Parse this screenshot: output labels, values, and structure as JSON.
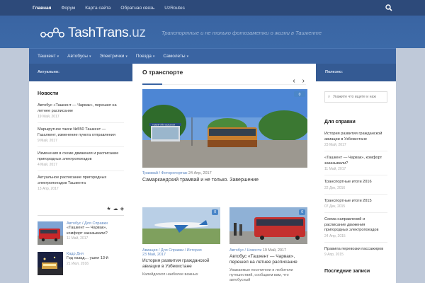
{
  "topnav": [
    "Главная",
    "Форум",
    "Карта сайта",
    "Обратная связь",
    "UzRoutes"
  ],
  "logo": {
    "name": "TashTrans",
    "suffix": ".uz"
  },
  "tagline": "Транспортные и не только фотозаметки о жизни в Ташкенте",
  "mainnav": [
    "Ташкент",
    "Автобусы",
    "Электрички",
    "Поезда",
    "Самолеты"
  ],
  "subbar": {
    "left": "Актуально:",
    "right": "Полезно:"
  },
  "left": {
    "news_heading": "Новости",
    "news": [
      {
        "title": "Автобус «Ташкент — Чарвак», перешел на летнее расписание",
        "date": "19 Май, 2017"
      },
      {
        "title": "Маршрутное такси №550 Ташкент — Газалкент, изменение пункта отправления",
        "date": "9 Май, 2017"
      },
      {
        "title": "Изменения в схеме движения и расписание пригородных электропоездов",
        "date": "4 Май, 2017"
      },
      {
        "title": "Актуальное расписание пригородных электропоездов Ташкента",
        "date": "13 Апр, 2017"
      }
    ],
    "posts": [
      {
        "cat": "Автобус / Для Справки",
        "title": "«Ташкент — Чарвак», комфорт заказывали?",
        "date": "11 Май, 2017"
      },
      {
        "cat": "Кадр Дня",
        "title": "Год назад… ушел 13-й",
        "date": "21 Июл, 2016"
      }
    ]
  },
  "main": {
    "title": "О транспорте",
    "feature": {
      "cat": "Трамвай / Фоторепортаж",
      "date": "24 Апр, 2017",
      "title": "Самаркандский трамвай и не только. Завершение",
      "comments": "0",
      "sign": "ТЕМИР ЙЎЛ ВОКЗАЛИ"
    },
    "posts": [
      {
        "cat": "Авиация / Для Справки / История",
        "date": "23 Май, 2017",
        "title": "История развития гражданской авиации в Узбекистане",
        "excerpt": "Калейдоскоп наиболее важных",
        "comments": "0"
      },
      {
        "cat": "Автобус / Новости",
        "date": "19 Май, 2017",
        "title": "Автобус «Ташкент — Чарвак», перешел на летнее расписание",
        "excerpt": "Уважаемые посетители и любители путешествий, сообщаем вам, что автобусный",
        "comments": "0"
      }
    ]
  },
  "right": {
    "search_placeholder": "Укажите что ищете и наж",
    "heading": "Для справки",
    "items": [
      {
        "title": "История развития гражданской авиации в Узбекистане",
        "date": "23 Май, 2017"
      },
      {
        "title": "«Ташкент — Чарвак», комфорт заказывали?",
        "date": "11 Май, 2017"
      },
      {
        "title": "Транспортные итоги 2016",
        "date": "22 Дек, 2016"
      },
      {
        "title": "Транспортные итоги 2015",
        "date": "07 Дек, 2015"
      },
      {
        "title": "Схема направлений и расписание движения пригородных электропоездов",
        "date": "24 Апр, 2015"
      },
      {
        "title": "Правила перевозки пассажиров",
        "date": "9 Апр, 2015"
      }
    ],
    "heading2": "Последние записи"
  }
}
